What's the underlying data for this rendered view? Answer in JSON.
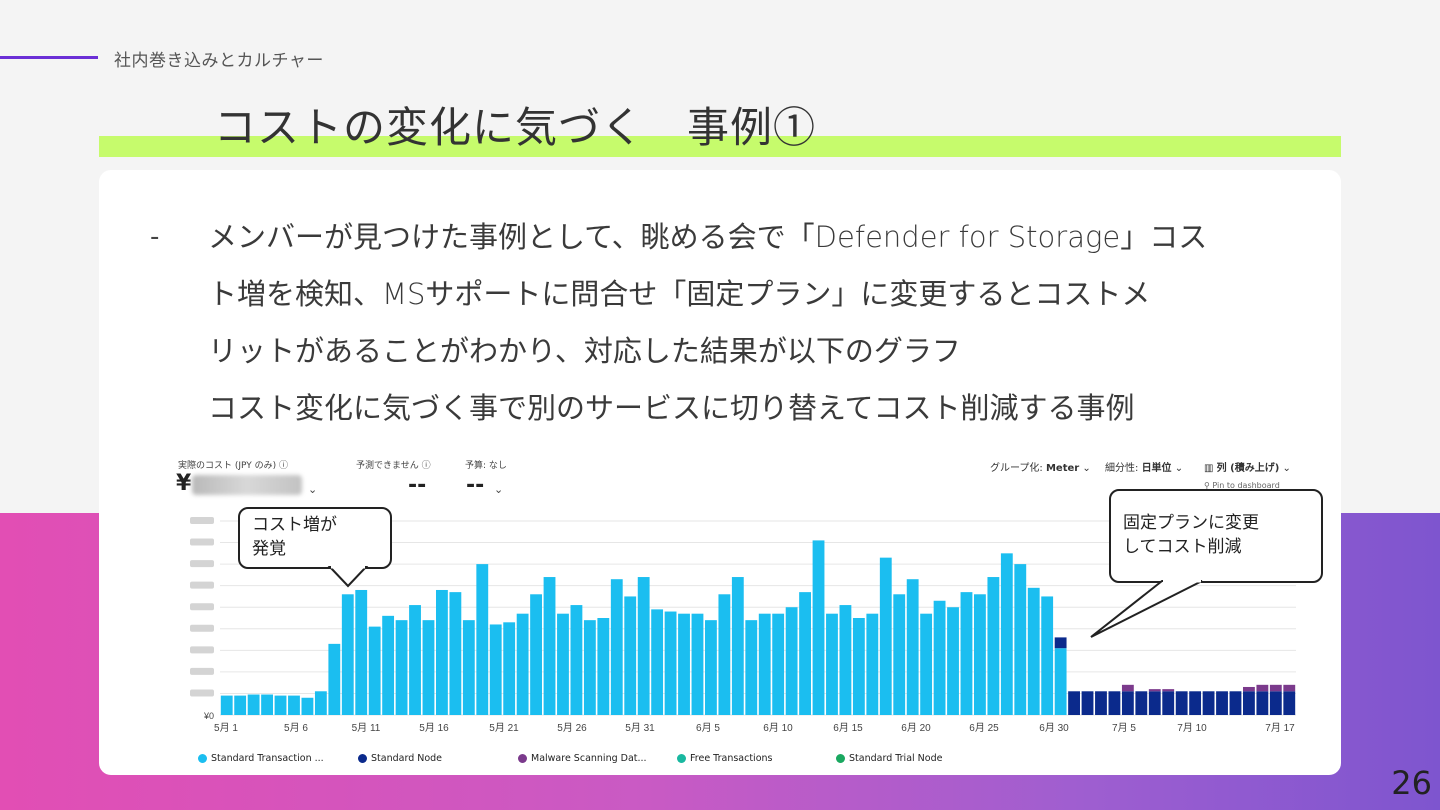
{
  "section": "社内巻き込みとカルチャー",
  "title": "コストの変化に気づく　事例①",
  "bullet": "-",
  "body_lines": [
    "メンバーが見つけた事例として、眺める会で「Defender for Storage」コス",
    "ト増を検知、MSサポートに問合せ「固定プラン」に変更するとコストメ",
    "リットがあることがわかり、対応した結果が以下のグラフ",
    "コスト変化に気づく事で別のサービスに切り替えてコスト削減する事例"
  ],
  "page_number": "26",
  "screenshot": {
    "actual_cost_label": "実際のコスト (JPY のみ)",
    "actual_cost_prefix": "¥",
    "forecast_label": "予測できません",
    "forecast_value": "--",
    "budget_label": "予算: なし",
    "budget_value": "--",
    "group_label": "グループ化:",
    "group_value": "Meter",
    "granularity_label": "細分性:",
    "granularity_value": "日単位",
    "view_value": "列 (積み上げ)",
    "pin_label": "Pin to dashboard",
    "y_zero_label": "¥0",
    "callout_left": [
      "コスト増が",
      "発覚"
    ],
    "callout_right": [
      "固定プランに変更",
      "してコスト削減"
    ],
    "legend": [
      {
        "label": "Standard Transaction ...",
        "color": "#1bbef0"
      },
      {
        "label": "Standard Node",
        "color": "#0b2a8c"
      },
      {
        "label": "Malware Scanning Dat...",
        "color": "#7b3a8c"
      },
      {
        "label": "Free Transactions",
        "color": "#19b8a0"
      },
      {
        "label": "Standard Trial Node",
        "color": "#1aa860"
      }
    ]
  },
  "chart_data": {
    "type": "bar",
    "stacked": true,
    "x_tick_labels": [
      "5月 1",
      "5月 6",
      "5月 11",
      "5月 16",
      "5月 21",
      "5月 26",
      "5月 31",
      "6月 5",
      "6月 10",
      "6月 15",
      "6月 20",
      "6月 25",
      "6月 30",
      "7月 5",
      "7月 10",
      "7月 17"
    ],
    "y_tick_labels": [
      "¥0"
    ],
    "series": [
      {
        "name": "Standard Transaction ...",
        "color": "#1bbef0",
        "values": [
          9,
          9,
          9.5,
          9.5,
          9,
          9,
          8,
          11,
          33,
          56,
          58,
          41,
          46,
          44,
          51,
          44,
          58,
          57,
          44,
          70,
          42,
          43,
          47,
          56,
          64,
          47,
          51,
          44,
          45,
          63,
          55,
          64,
          49,
          48,
          47,
          47,
          44,
          56,
          64,
          44,
          47,
          47,
          50,
          57,
          81,
          47,
          51,
          45,
          47,
          73,
          56,
          63,
          47,
          53,
          50,
          57,
          56,
          64,
          75,
          70,
          59,
          55,
          31,
          0,
          0,
          0,
          0,
          0,
          0,
          0,
          0,
          0,
          0,
          0,
          0,
          0,
          0,
          0,
          0,
          0
        ]
      },
      {
        "name": "Standard Node",
        "color": "#0b2a8c",
        "values": [
          0,
          0,
          0,
          0,
          0,
          0,
          0,
          0,
          0,
          0,
          0,
          0,
          0,
          0,
          0,
          0,
          0,
          0,
          0,
          0,
          0,
          0,
          0,
          0,
          0,
          0,
          0,
          0,
          0,
          0,
          0,
          0,
          0,
          0,
          0,
          0,
          0,
          0,
          0,
          0,
          0,
          0,
          0,
          0,
          0,
          0,
          0,
          0,
          0,
          0,
          0,
          0,
          0,
          0,
          0,
          0,
          0,
          0,
          0,
          0,
          0,
          0,
          5,
          11,
          11,
          11,
          11,
          11,
          11,
          11,
          11,
          11,
          11,
          11,
          11,
          11,
          11,
          11,
          11,
          11
        ]
      },
      {
        "name": "Malware Scanning Dat...",
        "color": "#7b3a8c",
        "values": [
          0,
          0,
          0,
          0,
          0,
          0,
          0,
          0,
          0,
          0,
          0,
          0,
          0,
          0,
          0,
          0,
          0,
          0,
          0,
          0,
          0,
          0,
          0,
          0,
          0,
          0,
          0,
          0,
          0,
          0,
          0,
          0,
          0,
          0,
          0,
          0,
          0,
          0,
          0,
          0,
          0,
          0,
          0,
          0,
          0,
          0,
          0,
          0,
          0,
          0,
          0,
          0,
          0,
          0,
          0,
          0,
          0,
          0,
          0,
          0,
          0,
          0,
          0,
          0,
          0,
          0,
          0,
          3,
          0,
          1,
          1,
          0,
          0,
          0,
          0,
          0,
          2,
          3,
          3,
          3
        ]
      }
    ],
    "legend_position": "bottom",
    "grid": true
  }
}
